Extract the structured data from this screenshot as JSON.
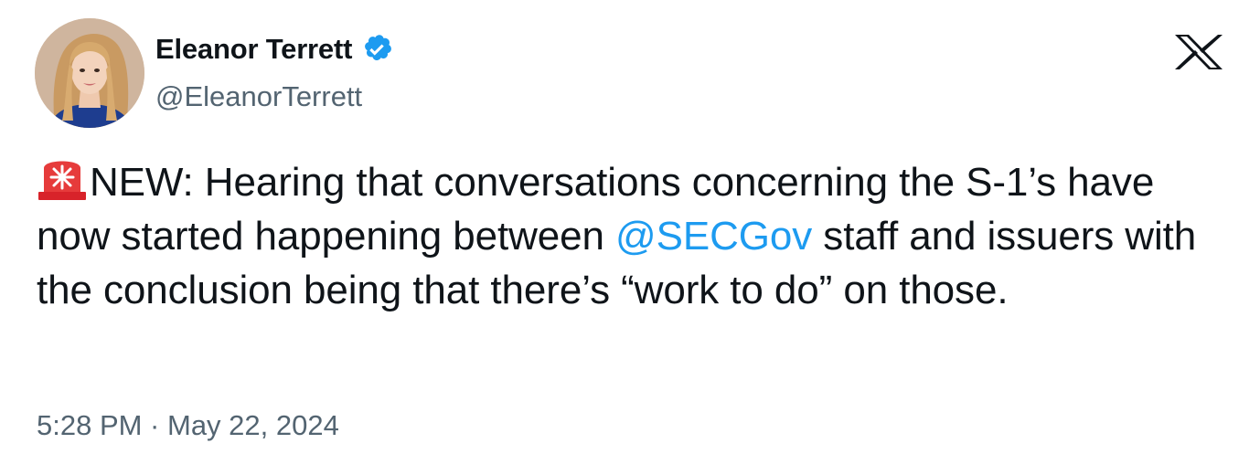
{
  "author": {
    "display_name": "Eleanor Terrett",
    "handle": "@EleanorTerrett",
    "verified": true,
    "avatar_icon": "profile-photo"
  },
  "platform": {
    "logo_icon": "x-logo-icon"
  },
  "tweet": {
    "emoji_icon": "police-light-siren-icon",
    "text_before_mention": "NEW: Hearing that conversations concerning the S-1’s have now started happening between ",
    "mention": "@SECGov",
    "text_after_mention": " staff and issuers with the conclusion being that there’s “work to do” on those."
  },
  "meta": {
    "timestamp": "5:28 PM · May 22, 2024"
  },
  "colors": {
    "text": "#0f1419",
    "secondary": "#536471",
    "link": "#1d9bf0",
    "verified_badge": "#1d9bf0"
  }
}
